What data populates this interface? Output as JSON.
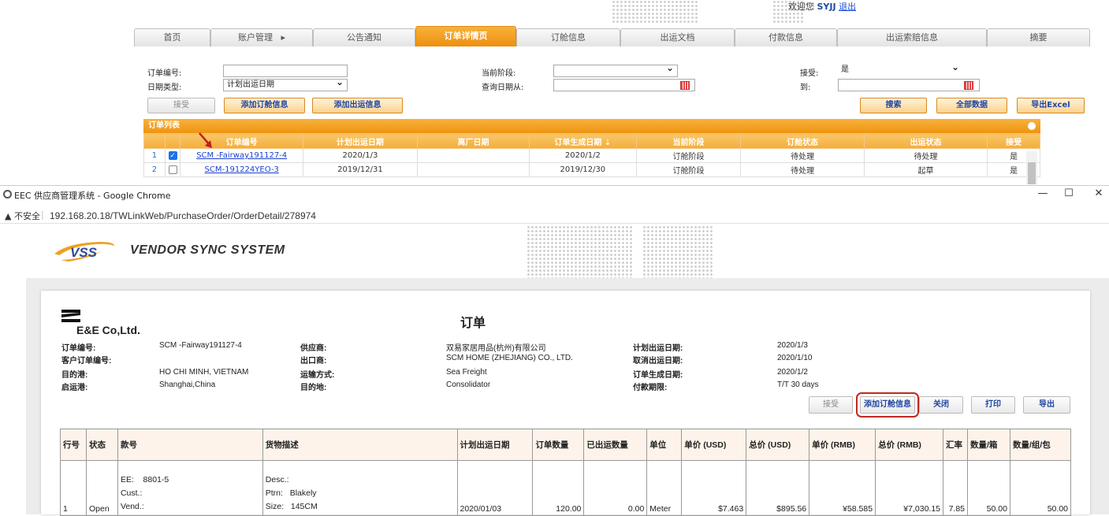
{
  "bg": {
    "welcome_text": "欢迎您",
    "user": "SYJJ",
    "logout": "退出",
    "tabs": [
      "首页",
      "账户管理",
      "公告通知",
      "订单详情页",
      "订舱信息",
      "出运文档",
      "付款信息",
      "出运索赔信息",
      "摘要"
    ],
    "tab_menu_arrow": "▸",
    "filters": {
      "order_no_label": "订单编号:",
      "date_type_label": "日期类型:",
      "date_type_value": "计划出运日期",
      "stage_label": "当前阶段:",
      "query_from_label": "查询日期从:",
      "accept_label": "接受:",
      "accept_value": "是",
      "to_label": "到:"
    },
    "buttons": {
      "accept": "接受",
      "add_booking": "添加订舱信息",
      "add_shipping": "添加出运信息",
      "search": "搜索",
      "all_data": "全部数据",
      "export_excel": "导出Excel"
    },
    "list_title": "订单列表",
    "columns": [
      "订单编号",
      "计划出运日期",
      "离厂日期",
      "订单生成日期",
      "当前阶段",
      "订舱状态",
      "出运状态",
      "接受"
    ],
    "sort_indicator": "⇣",
    "rows": [
      {
        "idx": "1",
        "checked": true,
        "order_no": "SCM -Fairway191127-4",
        "plan_ship": "2020/1/3",
        "leave": "",
        "created": "2020/1/2",
        "stage": "订舱阶段",
        "booking": "待处理",
        "shipping": "待处理",
        "accept": "是"
      },
      {
        "idx": "2",
        "checked": false,
        "order_no": "SCM-191224YEO-3",
        "plan_ship": "2019/12/31",
        "leave": "",
        "created": "2019/12/30",
        "stage": "订舱阶段",
        "booking": "待处理",
        "shipping": "起草",
        "accept": "是"
      }
    ]
  },
  "popup": {
    "window_title": "EEC 供应商管理系统 - Google Chrome",
    "controls": {
      "minimize": "—",
      "maximize": "☐",
      "close": "✕"
    },
    "insecure": "▲ 不安全",
    "url": "192.168.20.18/TWLinkWeb/PurchaseOrder/OrderDetail/278974",
    "logo_text": "VSS",
    "brand": "VENDOR SYNC SYSTEM",
    "company": "E&E Co,Ltd.",
    "doc_title": "订单",
    "info": {
      "col1": [
        {
          "k": "订单编号:",
          "v": "SCM -Fairway191127-4"
        },
        {
          "k": "客户订单编号:",
          "v": ""
        },
        {
          "k": "目的港:",
          "v": "HO CHI MINH, VIETNAM"
        },
        {
          "k": "启运港:",
          "v": "Shanghai,China"
        }
      ],
      "col2": [
        {
          "k": "供应商:",
          "v": "双易家居用品(杭州)有限公司"
        },
        {
          "k": "出口商:",
          "v": "SCM HOME (ZHEJIANG) CO., LTD."
        },
        {
          "k": "运输方式:",
          "v": "Sea Freight"
        },
        {
          "k": "目的地:",
          "v": "Consolidator"
        }
      ],
      "col3": [
        {
          "k": "计划出运日期:",
          "v": "2020/1/3"
        },
        {
          "k": "取消出运日期:",
          "v": "2020/1/10"
        },
        {
          "k": "订单生成日期:",
          "v": "2020/1/2"
        },
        {
          "k": "付款期限:",
          "v": "T/T 30 days"
        }
      ]
    },
    "buttons": {
      "accept": "接受",
      "add_booking": "添加订舱信息",
      "close": "关闭",
      "print": "打印",
      "export": "导出"
    },
    "table": {
      "headers": [
        "行号",
        "状态",
        "款号",
        "货物描述",
        "计划出运日期",
        "订单数量",
        "已出运数量",
        "单位",
        "单价 (USD)",
        "总价 (USD)",
        "单价 (RMB)",
        "总价 (RMB)",
        "汇率",
        "数量/箱",
        "数量/组/包"
      ],
      "row": {
        "line": "1",
        "status": "Open",
        "style": [
          "EE:    8801-5",
          "Cust.:",
          "Vend.:"
        ],
        "desc": [
          "Desc.:",
          "Ptrn:   Blakely",
          "Size:   145CM"
        ],
        "plan_date": "2020/01/03",
        "qty": "120.00",
        "shipped": "0.00",
        "unit": "Meter",
        "unit_usd": "$7.463",
        "total_usd": "$895.56",
        "unit_rmb": "¥58.585",
        "total_rmb": "¥7,030.15",
        "rate": "7.85",
        "per_box": "50.00",
        "per_pack": "50.00"
      }
    }
  }
}
